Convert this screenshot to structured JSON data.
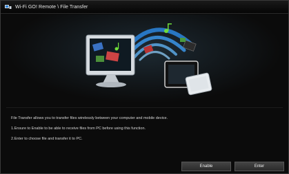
{
  "window": {
    "title": "Wi-Fi GO! Remote \\ File Transfer"
  },
  "description": {
    "line1": "File Transfer allows you to transfer files wirelessly between your computer and mobile device.",
    "line2": "1.Ensure to Enable to be able to receive files from PC before using this function.",
    "line3": "2.Enter to choose file and transfer it to PC."
  },
  "buttons": {
    "enable_label": "Enable",
    "enter_label": "Enter"
  },
  "colors": {
    "accent_wave": "#2a7fd4",
    "music_note": "#6fdc3a"
  },
  "icons": [
    "wifi-go-icon",
    "monitor-icon",
    "tablet-icon",
    "phone-icon",
    "music-note-icon",
    "wifi-waves-icon"
  ]
}
